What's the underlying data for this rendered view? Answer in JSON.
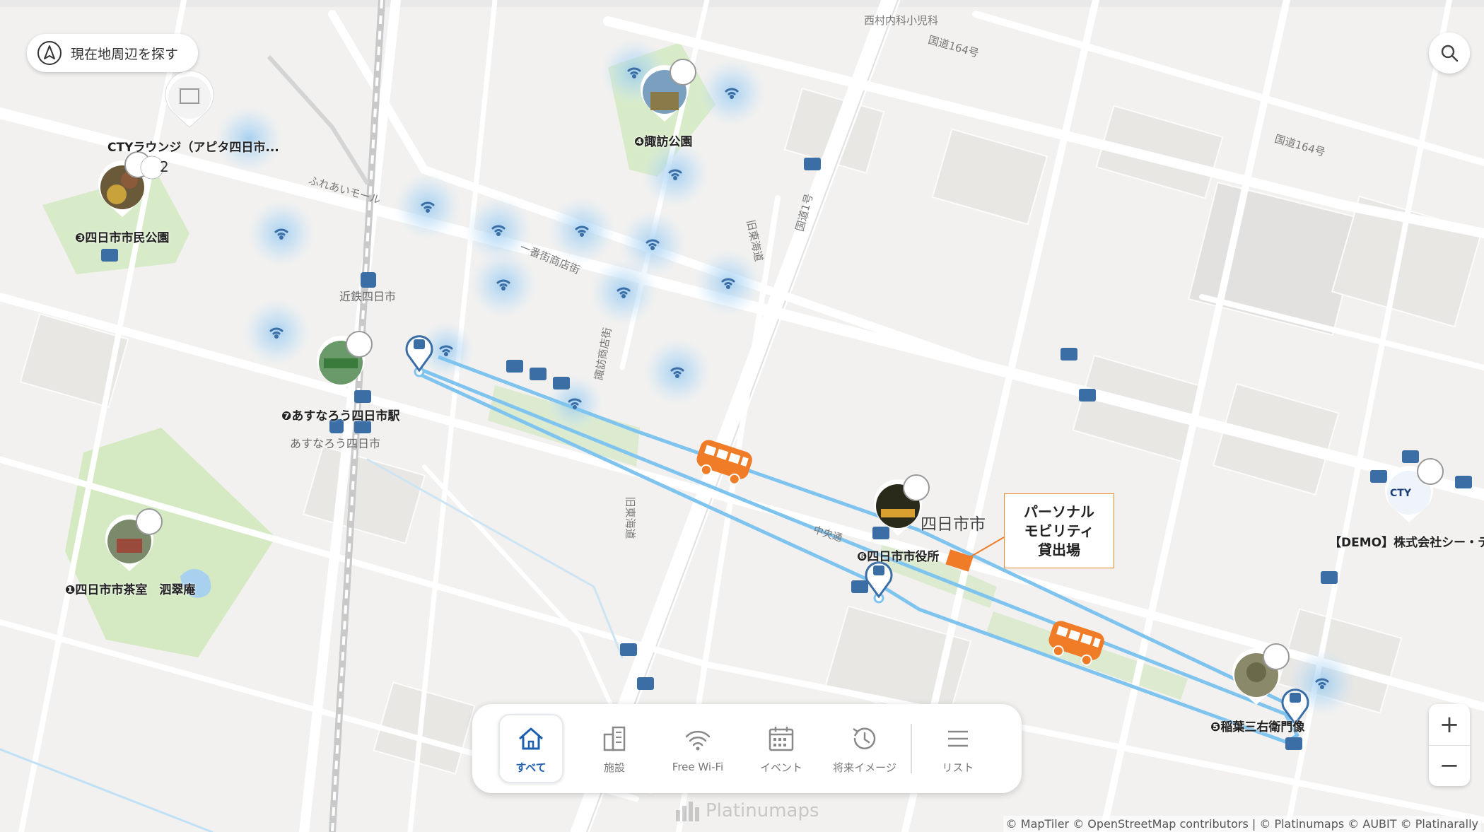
{
  "controls": {
    "locate_label": "現在地周辺を探す",
    "zoom_in": "+",
    "zoom_out": "−"
  },
  "tabs": [
    {
      "label": "すべて",
      "icon": "home-icon",
      "active": true
    },
    {
      "label": "施設",
      "icon": "building-icon",
      "active": false
    },
    {
      "label": "Free Wi-Fi",
      "icon": "wifi-icon",
      "active": false
    },
    {
      "label": "イベント",
      "icon": "calendar-icon",
      "active": false
    },
    {
      "label": "将来イメージ",
      "icon": "clock-history-icon",
      "active": false
    },
    {
      "label": "リスト",
      "icon": "list-icon",
      "active": false
    }
  ],
  "pois": [
    {
      "label": "❸四日市市民公園"
    },
    {
      "label": "❹諏訪公園"
    },
    {
      "label": "❼あすなろう四日市駅"
    },
    {
      "label": "❶四日市市茶室　泗翠庵"
    },
    {
      "label": "❻四日市市役所"
    },
    {
      "label": "❺稲葉三右衛門像"
    },
    {
      "label": "CTYラウンジ（アピタ四日市..."
    },
    {
      "label": "【DEMO】株式会社シー・テ"
    }
  ],
  "cluster_count": "2",
  "map_labels": {
    "yokkaichi_city": "四日市市",
    "kintetsu_station": "近鉄四日市",
    "asunarou_station": "あすなろう四日市",
    "clinic": "西村内科小児科",
    "route164_a": "国道164号",
    "route164_b": "国道164号",
    "ichiban_gai": "一番街商店街",
    "suwa_shotengai": "諏訪商店街",
    "fureai_mall": "ふれあいモール",
    "route1": "国道1号",
    "old_tokaido": "旧東海道",
    "old_tokaido2": "旧東海道",
    "chuo_dori": "中央通",
    "cty_logo": "CTY"
  },
  "callout": "パーソナル\nモビリティ\n貸出場",
  "watermark": "Platinumaps",
  "attribution": "© MapTiler © OpenStreetMap contributors | © Platinumaps © AUBIT © Platinarally",
  "colors": {
    "route": "#7fc4ef",
    "bus": "#f07c28",
    "park": "#d9ecc9",
    "wifi_glow": "#9ccbf0",
    "stop_blue": "#3a6ea5"
  }
}
